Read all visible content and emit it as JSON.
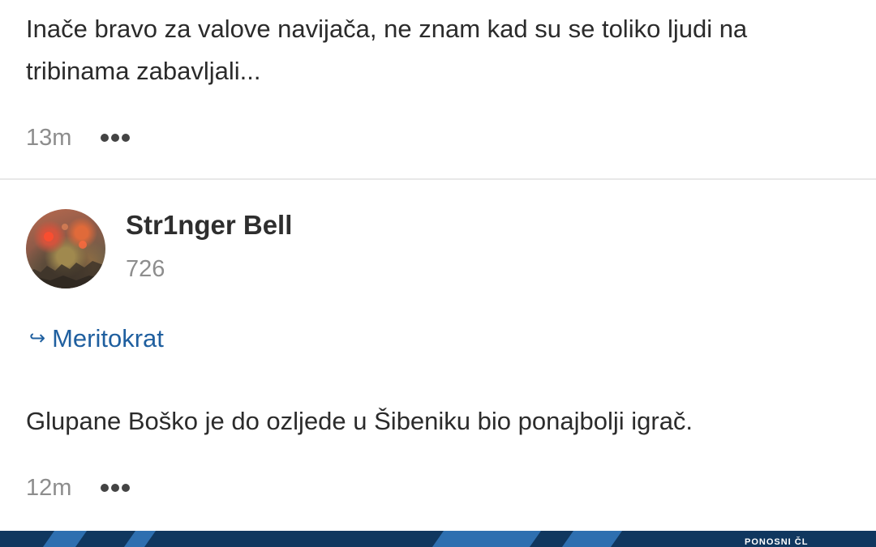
{
  "comments": [
    {
      "text": "Inače bravo za valove navijača, ne znam kad su se toliko ljudi na tribinama zabavljali...",
      "time": "13m"
    },
    {
      "username": "Str1nger Bell",
      "points": "726",
      "reply_to": "Meritokrat",
      "reply_icon": "reply-arrow-icon",
      "text": "Glupane Boško je do ozljede u Šibeniku bio ponajbolji igrač.",
      "time": "12m"
    }
  ],
  "banner": {
    "text": "PONOSNI ČL"
  },
  "colors": {
    "link": "#1f5f9f",
    "muted": "#8d8d8d",
    "text": "#2b2b2b",
    "banner": "#10375f"
  }
}
